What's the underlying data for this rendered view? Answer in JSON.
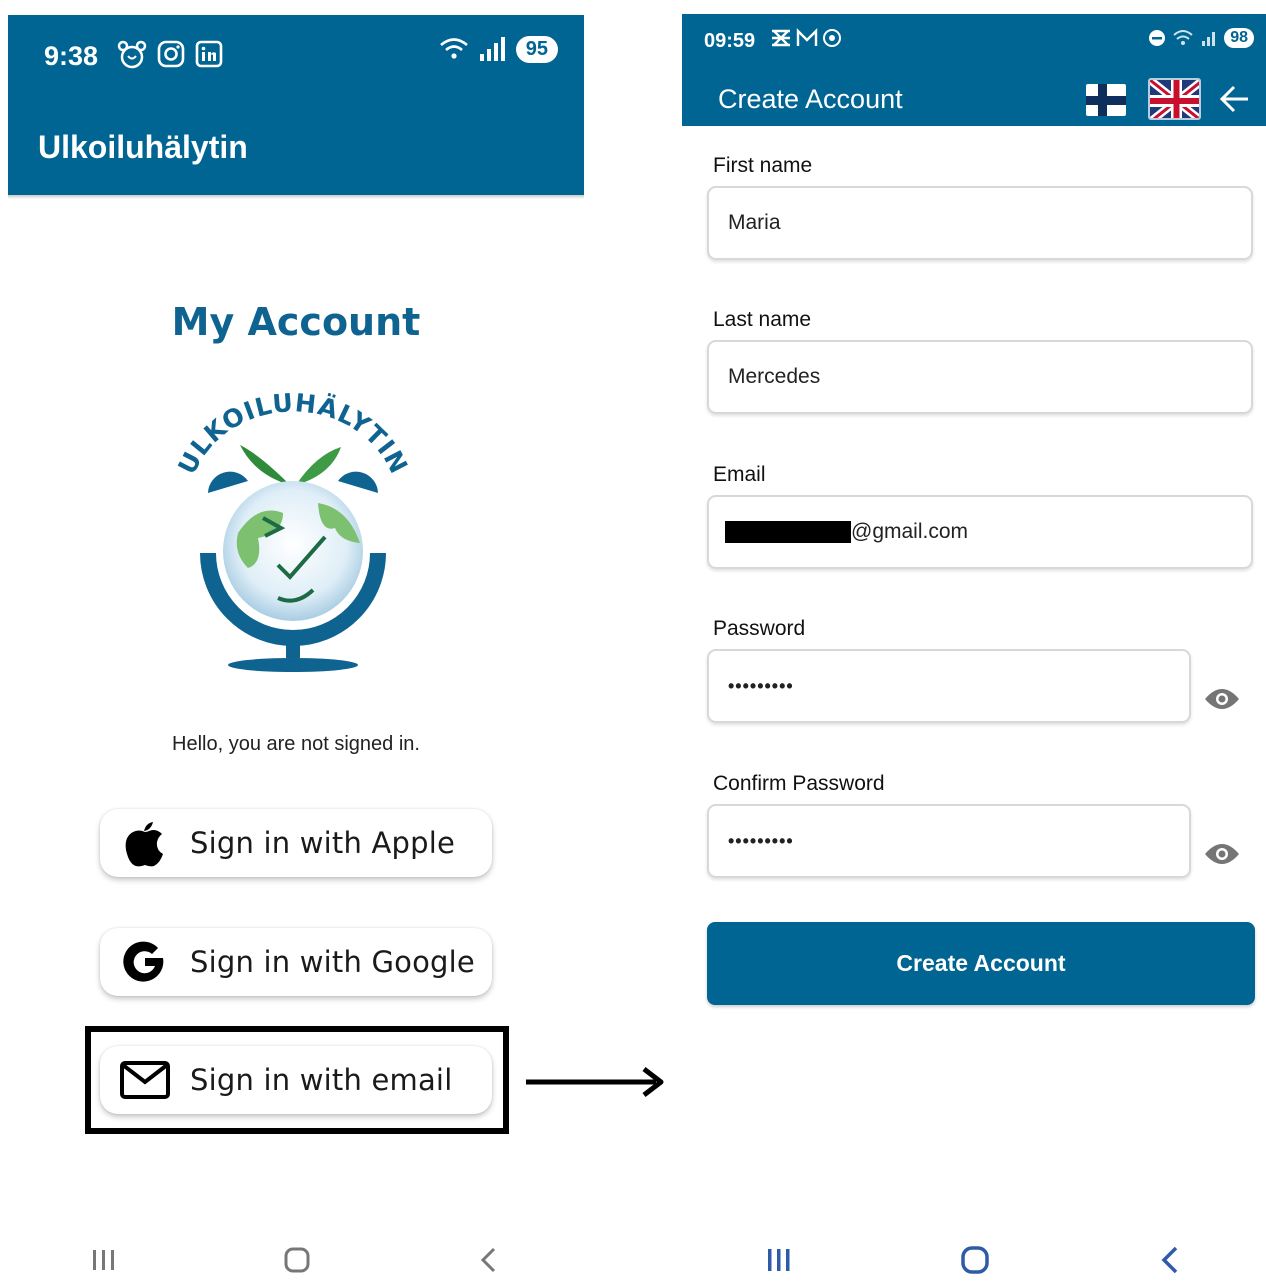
{
  "left": {
    "status": {
      "time": "9:38",
      "battery": "95"
    },
    "app_title": "Ulkoiluhälytin",
    "heading": "My Account",
    "logo_text": "ULKOILUHÄLYTIN",
    "greeting": "Hello, you are not signed in.",
    "buttons": {
      "apple": "Sign in with Apple",
      "google": "Sign in with Google",
      "email": "Sign in with email"
    }
  },
  "right": {
    "status": {
      "time": "09:59",
      "battery": "98"
    },
    "title": "Create Account",
    "fields": {
      "first_name": {
        "label": "First name",
        "value": "Maria"
      },
      "last_name": {
        "label": "Last name",
        "value": "Mercedes"
      },
      "email": {
        "label": "Email",
        "value": "@gmail.com"
      },
      "password": {
        "label": "Password",
        "value": "•••••••••"
      },
      "confirm_password": {
        "label": "Confirm Password",
        "value": "•••••••••"
      }
    },
    "submit": "Create Account"
  },
  "colors": {
    "primary": "#006593",
    "heading": "#0e6390"
  },
  "icons": [
    "alarm-clock-icon",
    "instagram-icon",
    "linkedin-icon",
    "wifi-icon",
    "signal-icon",
    "apple-icon",
    "google-icon",
    "mail-icon",
    "finnish-flag-icon",
    "uk-flag-icon",
    "back-arrow-icon",
    "eye-icon",
    "recents-icon",
    "home-icon",
    "back-icon"
  ]
}
